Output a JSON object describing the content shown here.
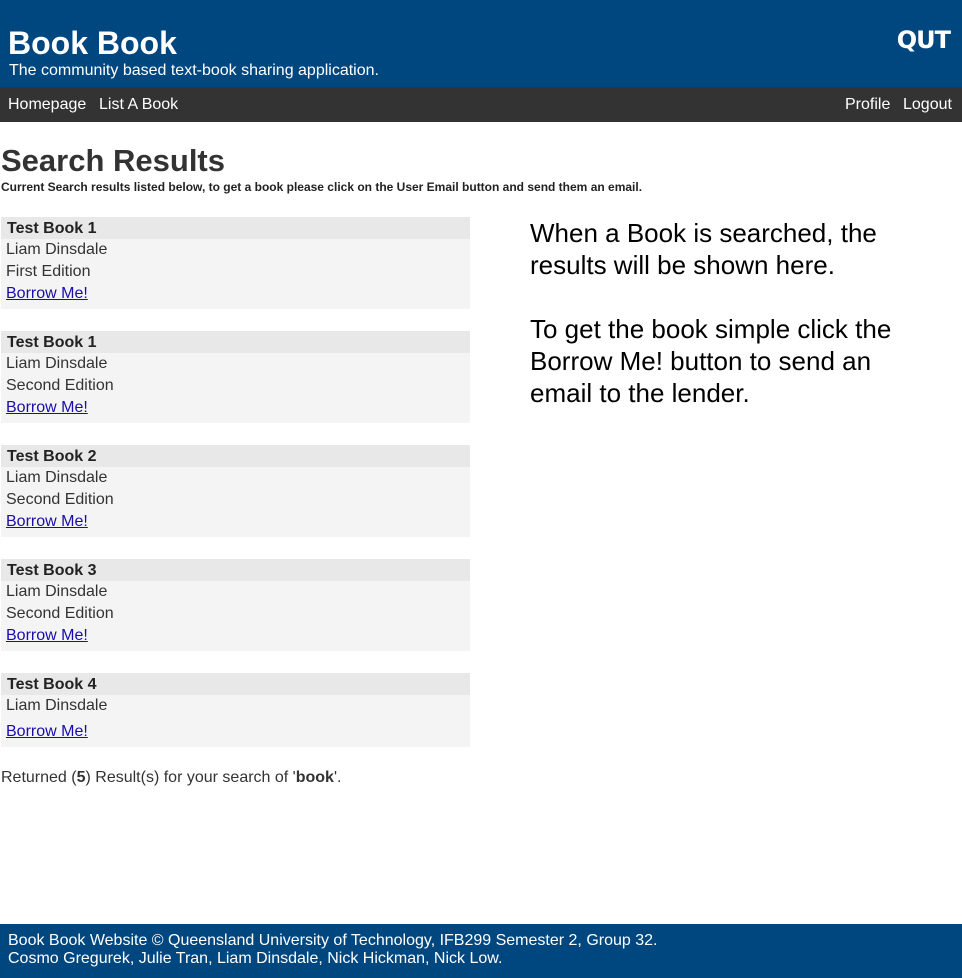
{
  "header": {
    "title": "Book Book",
    "tagline": "The community based text-book sharing application.",
    "logo": "QUT"
  },
  "nav": {
    "left": [
      "Homepage",
      "List A Book"
    ],
    "right": [
      "Profile",
      "Logout"
    ]
  },
  "page": {
    "title": "Search Results",
    "subtitle": "Current Search results listed below, to get a book please click on the User Email button and send them an email."
  },
  "results": [
    {
      "title": "Test Book 1",
      "author": "Liam Dinsdale",
      "edition": "First Edition",
      "action": "Borrow Me!"
    },
    {
      "title": "Test Book 1",
      "author": "Liam Dinsdale",
      "edition": "Second Edition",
      "action": "Borrow Me!"
    },
    {
      "title": "Test Book 2",
      "author": "Liam Dinsdale",
      "edition": "Second Edition",
      "action": "Borrow Me!"
    },
    {
      "title": "Test Book 3",
      "author": "Liam Dinsdale",
      "edition": "Second Edition",
      "action": "Borrow Me!"
    },
    {
      "title": "Test Book 4",
      "author": "Liam Dinsdale",
      "edition": "",
      "action": "Borrow Me!"
    }
  ],
  "help": {
    "paragraph1": "When a Book is searched, the results will be shown here.",
    "paragraph2": "To get the book simple click the Borrow Me! button to send an email to the lender."
  },
  "summary": {
    "prefix": "Returned (",
    "count": "5",
    "middle": ") Result(s) for your search of '",
    "query": "book",
    "suffix": "'."
  },
  "footer": {
    "line1": "Book Book Website © Queensland University of Technology, IFB299 Semester 2, Group 32.",
    "line2": "Cosmo Gregurek, Julie Tran, Liam Dinsdale, Nick Hickman, Nick Low."
  }
}
